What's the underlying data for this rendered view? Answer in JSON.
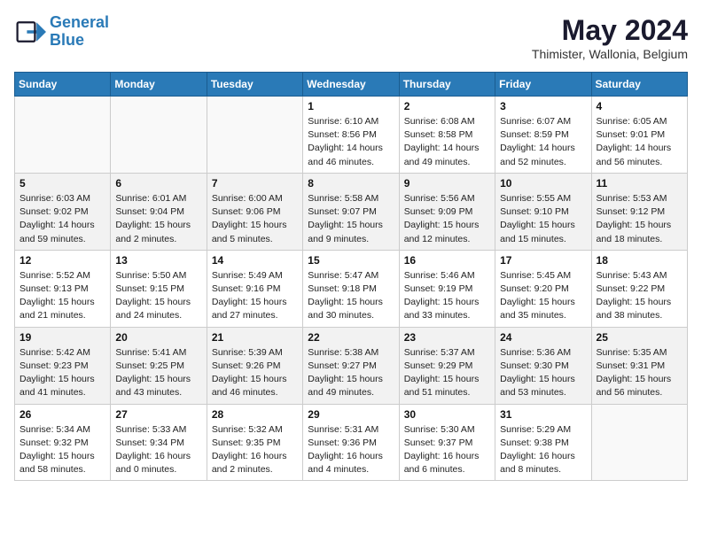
{
  "header": {
    "logo_line1": "General",
    "logo_line2": "Blue",
    "month_year": "May 2024",
    "location": "Thimister, Wallonia, Belgium"
  },
  "weekdays": [
    "Sunday",
    "Monday",
    "Tuesday",
    "Wednesday",
    "Thursday",
    "Friday",
    "Saturday"
  ],
  "rows": [
    [
      {
        "day": "",
        "text": ""
      },
      {
        "day": "",
        "text": ""
      },
      {
        "day": "",
        "text": ""
      },
      {
        "day": "1",
        "text": "Sunrise: 6:10 AM\nSunset: 8:56 PM\nDaylight: 14 hours\nand 46 minutes."
      },
      {
        "day": "2",
        "text": "Sunrise: 6:08 AM\nSunset: 8:58 PM\nDaylight: 14 hours\nand 49 minutes."
      },
      {
        "day": "3",
        "text": "Sunrise: 6:07 AM\nSunset: 8:59 PM\nDaylight: 14 hours\nand 52 minutes."
      },
      {
        "day": "4",
        "text": "Sunrise: 6:05 AM\nSunset: 9:01 PM\nDaylight: 14 hours\nand 56 minutes."
      }
    ],
    [
      {
        "day": "5",
        "text": "Sunrise: 6:03 AM\nSunset: 9:02 PM\nDaylight: 14 hours\nand 59 minutes."
      },
      {
        "day": "6",
        "text": "Sunrise: 6:01 AM\nSunset: 9:04 PM\nDaylight: 15 hours\nand 2 minutes."
      },
      {
        "day": "7",
        "text": "Sunrise: 6:00 AM\nSunset: 9:06 PM\nDaylight: 15 hours\nand 5 minutes."
      },
      {
        "day": "8",
        "text": "Sunrise: 5:58 AM\nSunset: 9:07 PM\nDaylight: 15 hours\nand 9 minutes."
      },
      {
        "day": "9",
        "text": "Sunrise: 5:56 AM\nSunset: 9:09 PM\nDaylight: 15 hours\nand 12 minutes."
      },
      {
        "day": "10",
        "text": "Sunrise: 5:55 AM\nSunset: 9:10 PM\nDaylight: 15 hours\nand 15 minutes."
      },
      {
        "day": "11",
        "text": "Sunrise: 5:53 AM\nSunset: 9:12 PM\nDaylight: 15 hours\nand 18 minutes."
      }
    ],
    [
      {
        "day": "12",
        "text": "Sunrise: 5:52 AM\nSunset: 9:13 PM\nDaylight: 15 hours\nand 21 minutes."
      },
      {
        "day": "13",
        "text": "Sunrise: 5:50 AM\nSunset: 9:15 PM\nDaylight: 15 hours\nand 24 minutes."
      },
      {
        "day": "14",
        "text": "Sunrise: 5:49 AM\nSunset: 9:16 PM\nDaylight: 15 hours\nand 27 minutes."
      },
      {
        "day": "15",
        "text": "Sunrise: 5:47 AM\nSunset: 9:18 PM\nDaylight: 15 hours\nand 30 minutes."
      },
      {
        "day": "16",
        "text": "Sunrise: 5:46 AM\nSunset: 9:19 PM\nDaylight: 15 hours\nand 33 minutes."
      },
      {
        "day": "17",
        "text": "Sunrise: 5:45 AM\nSunset: 9:20 PM\nDaylight: 15 hours\nand 35 minutes."
      },
      {
        "day": "18",
        "text": "Sunrise: 5:43 AM\nSunset: 9:22 PM\nDaylight: 15 hours\nand 38 minutes."
      }
    ],
    [
      {
        "day": "19",
        "text": "Sunrise: 5:42 AM\nSunset: 9:23 PM\nDaylight: 15 hours\nand 41 minutes."
      },
      {
        "day": "20",
        "text": "Sunrise: 5:41 AM\nSunset: 9:25 PM\nDaylight: 15 hours\nand 43 minutes."
      },
      {
        "day": "21",
        "text": "Sunrise: 5:39 AM\nSunset: 9:26 PM\nDaylight: 15 hours\nand 46 minutes."
      },
      {
        "day": "22",
        "text": "Sunrise: 5:38 AM\nSunset: 9:27 PM\nDaylight: 15 hours\nand 49 minutes."
      },
      {
        "day": "23",
        "text": "Sunrise: 5:37 AM\nSunset: 9:29 PM\nDaylight: 15 hours\nand 51 minutes."
      },
      {
        "day": "24",
        "text": "Sunrise: 5:36 AM\nSunset: 9:30 PM\nDaylight: 15 hours\nand 53 minutes."
      },
      {
        "day": "25",
        "text": "Sunrise: 5:35 AM\nSunset: 9:31 PM\nDaylight: 15 hours\nand 56 minutes."
      }
    ],
    [
      {
        "day": "26",
        "text": "Sunrise: 5:34 AM\nSunset: 9:32 PM\nDaylight: 15 hours\nand 58 minutes."
      },
      {
        "day": "27",
        "text": "Sunrise: 5:33 AM\nSunset: 9:34 PM\nDaylight: 16 hours\nand 0 minutes."
      },
      {
        "day": "28",
        "text": "Sunrise: 5:32 AM\nSunset: 9:35 PM\nDaylight: 16 hours\nand 2 minutes."
      },
      {
        "day": "29",
        "text": "Sunrise: 5:31 AM\nSunset: 9:36 PM\nDaylight: 16 hours\nand 4 minutes."
      },
      {
        "day": "30",
        "text": "Sunrise: 5:30 AM\nSunset: 9:37 PM\nDaylight: 16 hours\nand 6 minutes."
      },
      {
        "day": "31",
        "text": "Sunrise: 5:29 AM\nSunset: 9:38 PM\nDaylight: 16 hours\nand 8 minutes."
      },
      {
        "day": "",
        "text": ""
      }
    ]
  ]
}
